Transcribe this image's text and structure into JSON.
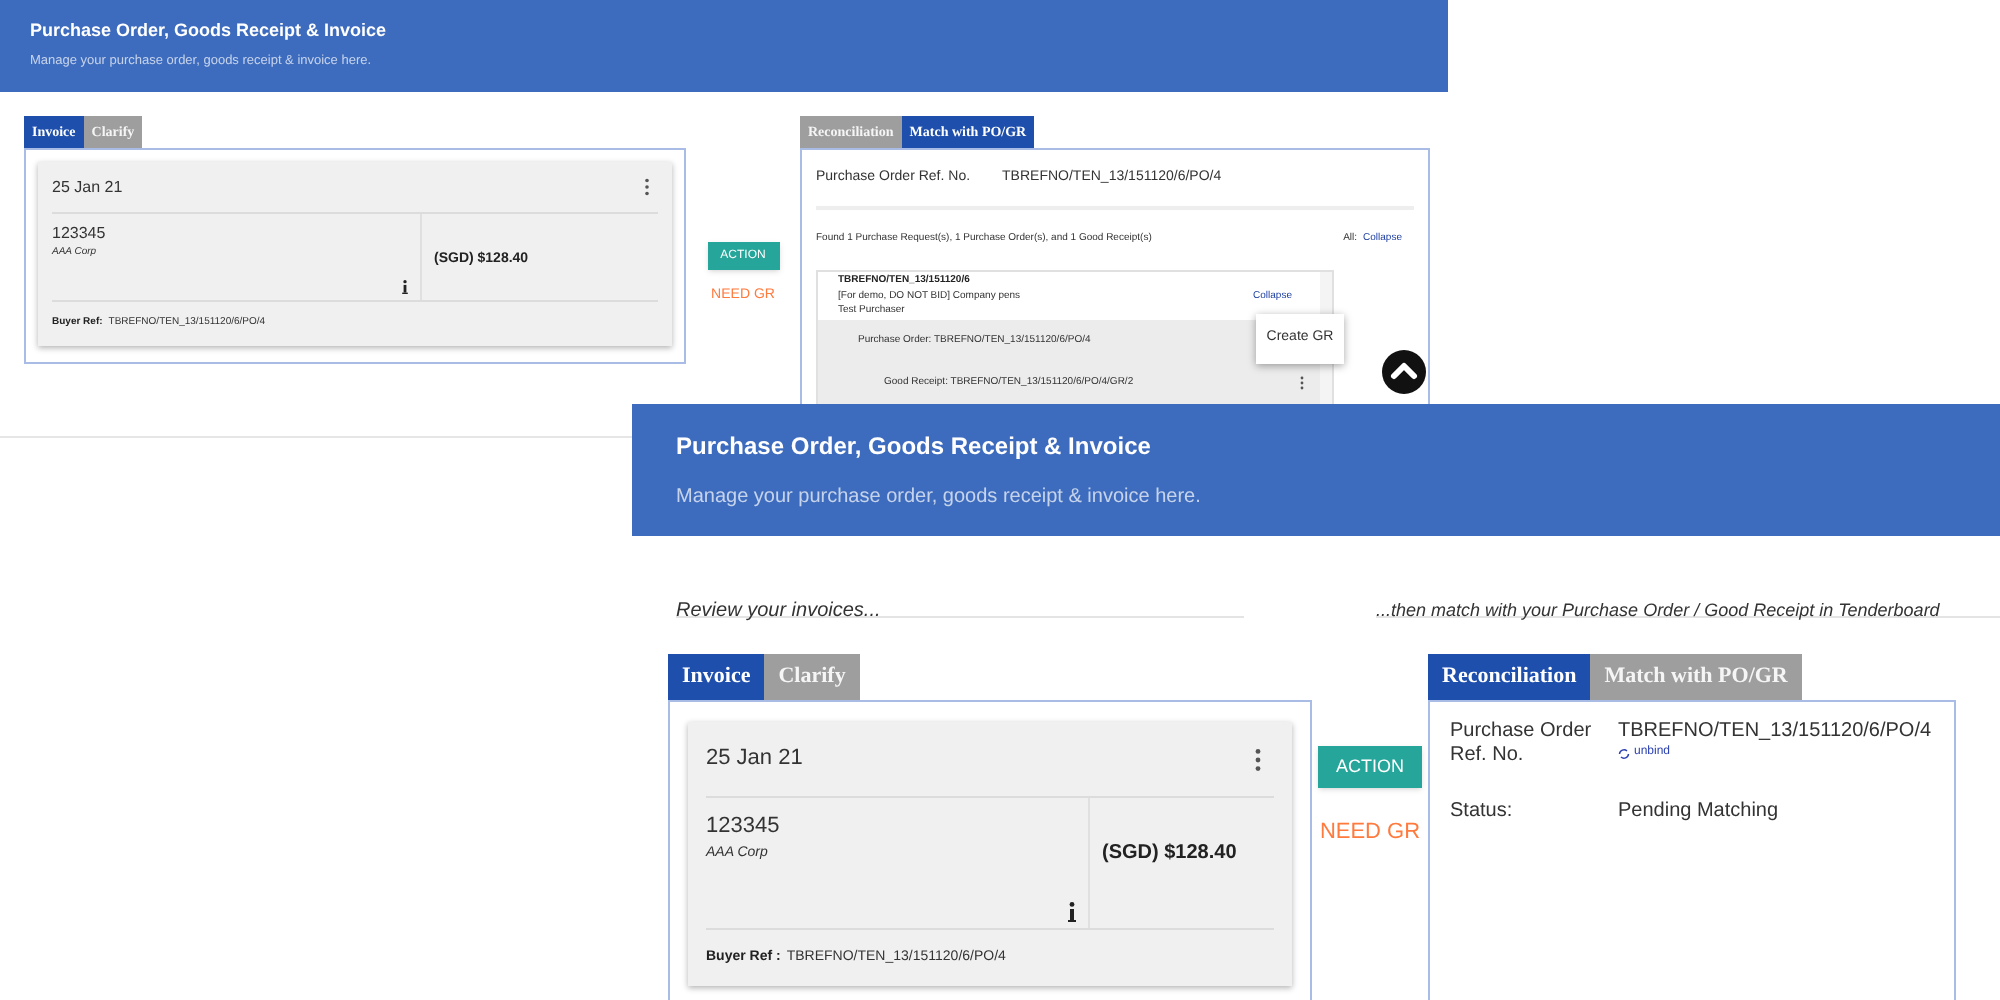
{
  "back_screen": {
    "header": {
      "title": "Purchase Order, Goods Receipt & Invoice",
      "subtitle": "Manage your purchase order, goods receipt & invoice here."
    },
    "invoice_tabs": [
      {
        "label": "Invoice",
        "selected": true
      },
      {
        "label": "Clarify",
        "selected": false
      }
    ],
    "invoice_card": {
      "date": "25 Jan 21",
      "number": "123345",
      "company": "AAA Corp",
      "amount": "(SGD) $128.40",
      "buyer_ref_label": "Buyer Ref:",
      "buyer_ref": "TBREFNO/TEN_13/151120/6/PO/4"
    },
    "action_button": "ACTION",
    "status_note": "NEED GR",
    "recon_tabs": [
      {
        "label": "Reconciliation",
        "selected": false
      },
      {
        "label": "Match with PO/GR",
        "selected": true
      }
    ],
    "match_panel": {
      "ref_label": "Purchase Order Ref. No.",
      "ref_value": "TBREFNO/TEN_13/151120/6/PO/4",
      "found_text": "Found 1 Purchase Request(s), 1 Purchase Order(s), and 1 Good Receipt(s)",
      "all_label": "All:",
      "all_link": "Collapse",
      "request": {
        "title": "TBREFNO/TEN_13/151120/6",
        "description": "[For demo, DO NOT BID] Company pens",
        "purchaser": "Test Purchaser",
        "link": "Collapse"
      },
      "purchase_order": "Purchase Order: TBREFNO/TEN_13/151120/6/PO/4",
      "good_receipt": "Good Receipt: TBREFNO/TEN_13/151120/6/PO/4/GR/2",
      "menu_item": "Create GR"
    }
  },
  "front_screen": {
    "header": {
      "title": "Purchase Order, Goods Receipt & Invoice",
      "subtitle": "Manage your purchase order, goods receipt & invoice here."
    },
    "captions": [
      "Review your invoices...",
      "...then match with your Purchase Order / Good Receipt in Tenderboard"
    ],
    "invoice_tabs": [
      {
        "label": "Invoice",
        "selected": true
      },
      {
        "label": "Clarify",
        "selected": false
      }
    ],
    "invoice_card": {
      "date": "25 Jan 21",
      "number": "123345",
      "company": "AAA Corp",
      "amount": "(SGD) $128.40",
      "buyer_ref_label": "Buyer Ref :",
      "buyer_ref": "TBREFNO/TEN_13/151120/6/PO/4"
    },
    "action_button": "ACTION",
    "status_note": "NEED GR",
    "recon_tabs": [
      {
        "label": "Reconciliation",
        "selected": true
      },
      {
        "label": "Match with PO/GR",
        "selected": false
      }
    ],
    "recon_panel": {
      "ref_label": "Purchase Order Ref. No.",
      "ref_value": "TBREFNO/TEN_13/151120/6/PO/4",
      "unbind_link": "unbind",
      "status_label": "Status:",
      "status_value": "Pending Matching"
    }
  }
}
